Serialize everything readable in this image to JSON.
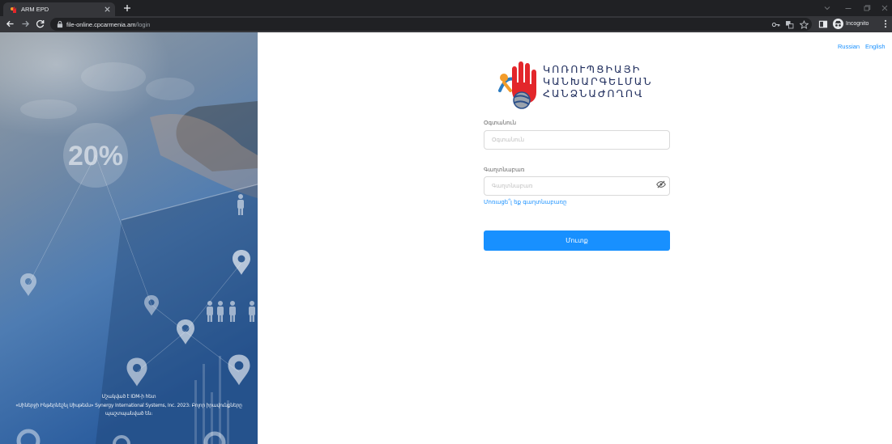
{
  "browser": {
    "tab_title": "ARM EPD",
    "url_host": "file-online.cpcarmenia.am",
    "url_path": "/login",
    "profile_label": "Incognito"
  },
  "languages": [
    "Russian",
    "English"
  ],
  "logo": {
    "lines": [
      "ԿՈՌՈՒՊՑԻԱՅԻ",
      "ԿԱՆԽԱՐԳԵԼՄԱՆ",
      "ՀԱՆՁՆԱԺՈՂՈՎ"
    ]
  },
  "form": {
    "username_label": "Օգտանուն",
    "username_placeholder": "Օգտանուն",
    "username_value": "",
    "password_label": "Գաղտնաբառ",
    "password_placeholder": "Գաղտնաբառ",
    "password_value": "",
    "forgot_link": "Մոռացե՞լ եք գաղտնաբառը",
    "submit_label": "Մուտք"
  },
  "hero": {
    "badge_text": "20%"
  },
  "footer": {
    "lines": [
      "Մշակված է IDM-ի հետ",
      "«Սիներջի Ինթերնեշնլ Սիսթեմս» Synergy International Systems, Inc. 2023։ Բոլոր իրավունքները",
      "պաշտպանված են։"
    ]
  },
  "colors": {
    "accent": "#1890ff",
    "logo_text": "#22305f",
    "logo_hand": "#e3262b",
    "chrome_dark": "#202124",
    "chrome_toolbar": "#35363a"
  }
}
